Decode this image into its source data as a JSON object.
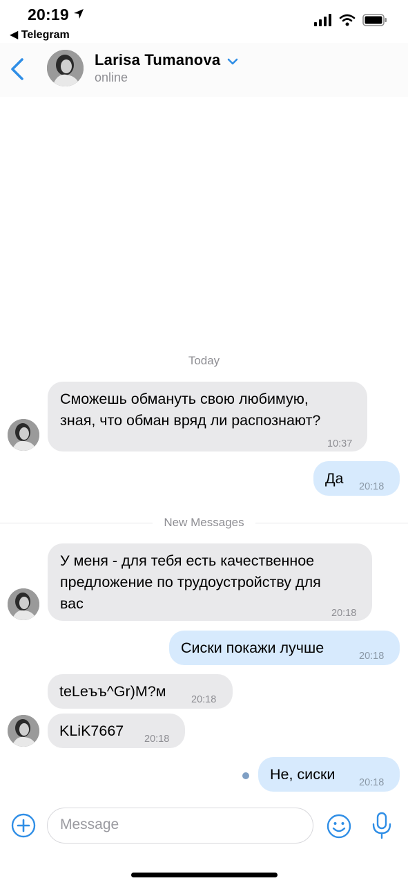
{
  "status_bar": {
    "time": "20:19",
    "back_app": "◀ Telegram"
  },
  "header": {
    "contact_name": "Larisa Tumanova",
    "contact_status": "online",
    "accent_color": "#2f8ee6"
  },
  "chat": {
    "today_label": "Today",
    "new_messages_label": "New Messages",
    "messages": [
      {
        "direction": "in",
        "text": "Сможешь обмануть свою любимую, зная, что обман вряд ли распознают?",
        "line1": "Сможешь обмануть свою любимую,",
        "line2": "зная, что обман вряд ли распознают?",
        "time": "10:37"
      },
      {
        "direction": "out",
        "text": "Да",
        "time": "20:18"
      },
      {
        "direction": "in",
        "text": "У меня - для тебя есть качественное предложение по трудоустройству для вас",
        "line1": "У меня - для тебя есть качественное",
        "line2": "предложение по трудоустройству для",
        "line3": "вас",
        "time": "20:18"
      },
      {
        "direction": "out",
        "text": "Сиски покажи лучше",
        "time": "20:18"
      },
      {
        "direction": "in",
        "text": "teLeъъ^Gr)M?м",
        "time": "20:18"
      },
      {
        "direction": "in",
        "text": "KLiK7667",
        "time": "20:18"
      },
      {
        "direction": "out",
        "text": "Не, сиски",
        "time": "20:18",
        "status": "unread"
      }
    ]
  },
  "input": {
    "placeholder": "Message",
    "value": ""
  },
  "colors": {
    "incoming_bubble": "#e9e9eb",
    "outgoing_bubble": "#d7eafd",
    "accent": "#2f8ee6"
  }
}
